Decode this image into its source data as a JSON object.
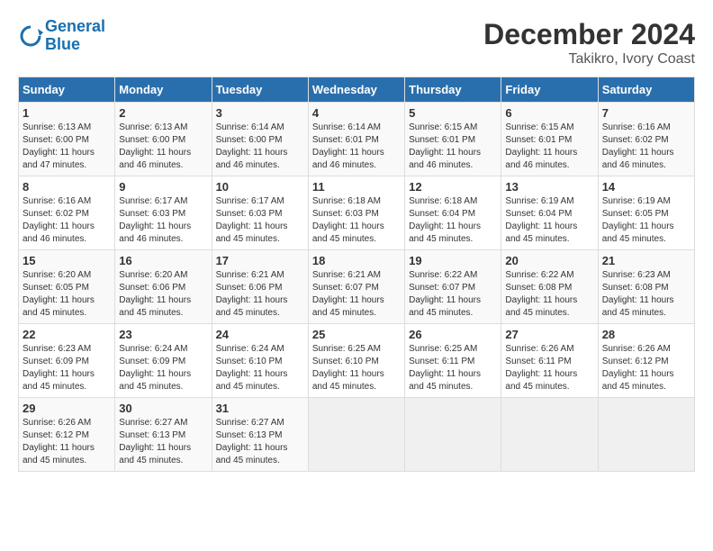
{
  "logo": {
    "line1": "General",
    "line2": "Blue"
  },
  "title": "December 2024",
  "subtitle": "Takikro, Ivory Coast",
  "headers": [
    "Sunday",
    "Monday",
    "Tuesday",
    "Wednesday",
    "Thursday",
    "Friday",
    "Saturday"
  ],
  "weeks": [
    [
      {
        "day": "1",
        "info": "Sunrise: 6:13 AM\nSunset: 6:00 PM\nDaylight: 11 hours\nand 47 minutes."
      },
      {
        "day": "2",
        "info": "Sunrise: 6:13 AM\nSunset: 6:00 PM\nDaylight: 11 hours\nand 46 minutes."
      },
      {
        "day": "3",
        "info": "Sunrise: 6:14 AM\nSunset: 6:00 PM\nDaylight: 11 hours\nand 46 minutes."
      },
      {
        "day": "4",
        "info": "Sunrise: 6:14 AM\nSunset: 6:01 PM\nDaylight: 11 hours\nand 46 minutes."
      },
      {
        "day": "5",
        "info": "Sunrise: 6:15 AM\nSunset: 6:01 PM\nDaylight: 11 hours\nand 46 minutes."
      },
      {
        "day": "6",
        "info": "Sunrise: 6:15 AM\nSunset: 6:01 PM\nDaylight: 11 hours\nand 46 minutes."
      },
      {
        "day": "7",
        "info": "Sunrise: 6:16 AM\nSunset: 6:02 PM\nDaylight: 11 hours\nand 46 minutes."
      }
    ],
    [
      {
        "day": "8",
        "info": "Sunrise: 6:16 AM\nSunset: 6:02 PM\nDaylight: 11 hours\nand 46 minutes."
      },
      {
        "day": "9",
        "info": "Sunrise: 6:17 AM\nSunset: 6:03 PM\nDaylight: 11 hours\nand 46 minutes."
      },
      {
        "day": "10",
        "info": "Sunrise: 6:17 AM\nSunset: 6:03 PM\nDaylight: 11 hours\nand 45 minutes."
      },
      {
        "day": "11",
        "info": "Sunrise: 6:18 AM\nSunset: 6:03 PM\nDaylight: 11 hours\nand 45 minutes."
      },
      {
        "day": "12",
        "info": "Sunrise: 6:18 AM\nSunset: 6:04 PM\nDaylight: 11 hours\nand 45 minutes."
      },
      {
        "day": "13",
        "info": "Sunrise: 6:19 AM\nSunset: 6:04 PM\nDaylight: 11 hours\nand 45 minutes."
      },
      {
        "day": "14",
        "info": "Sunrise: 6:19 AM\nSunset: 6:05 PM\nDaylight: 11 hours\nand 45 minutes."
      }
    ],
    [
      {
        "day": "15",
        "info": "Sunrise: 6:20 AM\nSunset: 6:05 PM\nDaylight: 11 hours\nand 45 minutes."
      },
      {
        "day": "16",
        "info": "Sunrise: 6:20 AM\nSunset: 6:06 PM\nDaylight: 11 hours\nand 45 minutes."
      },
      {
        "day": "17",
        "info": "Sunrise: 6:21 AM\nSunset: 6:06 PM\nDaylight: 11 hours\nand 45 minutes."
      },
      {
        "day": "18",
        "info": "Sunrise: 6:21 AM\nSunset: 6:07 PM\nDaylight: 11 hours\nand 45 minutes."
      },
      {
        "day": "19",
        "info": "Sunrise: 6:22 AM\nSunset: 6:07 PM\nDaylight: 11 hours\nand 45 minutes."
      },
      {
        "day": "20",
        "info": "Sunrise: 6:22 AM\nSunset: 6:08 PM\nDaylight: 11 hours\nand 45 minutes."
      },
      {
        "day": "21",
        "info": "Sunrise: 6:23 AM\nSunset: 6:08 PM\nDaylight: 11 hours\nand 45 minutes."
      }
    ],
    [
      {
        "day": "22",
        "info": "Sunrise: 6:23 AM\nSunset: 6:09 PM\nDaylight: 11 hours\nand 45 minutes."
      },
      {
        "day": "23",
        "info": "Sunrise: 6:24 AM\nSunset: 6:09 PM\nDaylight: 11 hours\nand 45 minutes."
      },
      {
        "day": "24",
        "info": "Sunrise: 6:24 AM\nSunset: 6:10 PM\nDaylight: 11 hours\nand 45 minutes."
      },
      {
        "day": "25",
        "info": "Sunrise: 6:25 AM\nSunset: 6:10 PM\nDaylight: 11 hours\nand 45 minutes."
      },
      {
        "day": "26",
        "info": "Sunrise: 6:25 AM\nSunset: 6:11 PM\nDaylight: 11 hours\nand 45 minutes."
      },
      {
        "day": "27",
        "info": "Sunrise: 6:26 AM\nSunset: 6:11 PM\nDaylight: 11 hours\nand 45 minutes."
      },
      {
        "day": "28",
        "info": "Sunrise: 6:26 AM\nSunset: 6:12 PM\nDaylight: 11 hours\nand 45 minutes."
      }
    ],
    [
      {
        "day": "29",
        "info": "Sunrise: 6:26 AM\nSunset: 6:12 PM\nDaylight: 11 hours\nand 45 minutes."
      },
      {
        "day": "30",
        "info": "Sunrise: 6:27 AM\nSunset: 6:13 PM\nDaylight: 11 hours\nand 45 minutes."
      },
      {
        "day": "31",
        "info": "Sunrise: 6:27 AM\nSunset: 6:13 PM\nDaylight: 11 hours\nand 45 minutes."
      },
      null,
      null,
      null,
      null
    ]
  ]
}
